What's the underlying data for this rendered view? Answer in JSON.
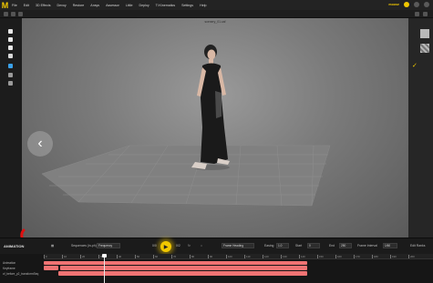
{
  "app": {
    "logo_letter": "M",
    "brand": "moose",
    "accent_color": "#f2c800"
  },
  "menu": [
    "File",
    "Edit",
    "3D Effects",
    "Devoy",
    "Restore",
    "Ansys",
    "Assessor",
    "Little",
    "Deploy",
    "Ti Kinematics",
    "Settings",
    "Help"
  ],
  "viewport": {
    "title": "scenery_01.caf",
    "nav_icon": "chevron-left-icon"
  },
  "bottom_bar": {
    "panel_label": "ANIMATION",
    "label_1": "Sequences (in-ph)",
    "field_1": "Frequency",
    "frame_start": "0/0",
    "frame_end": "0/2",
    "mode_field": "Frame Heading",
    "label_2": "Easing",
    "field_2": "1.0",
    "label_3": "Start",
    "field_3": "0",
    "label_4": "End",
    "field_4": "250",
    "label_5": "Frame Interval",
    "field_5": "1/60",
    "label_6": "Edit Ranks"
  },
  "timeline": {
    "ticks": [
      "0",
      "10",
      "20",
      "30",
      "40",
      "50",
      "60",
      "70",
      "80",
      "90",
      "100",
      "110",
      "120",
      "130",
      "140",
      "150",
      "160",
      "170",
      "180",
      "190",
      "200"
    ],
    "tracks": [
      {
        "label": "Animation"
      },
      {
        "label": "Keyframe"
      },
      {
        "label": "cf_before_y2_transformSeq"
      }
    ],
    "playhead_frame": 25,
    "bar_color": "#f07373"
  }
}
